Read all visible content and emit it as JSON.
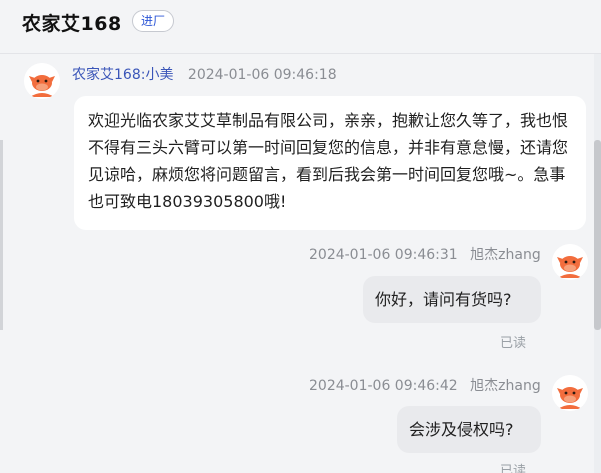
{
  "header": {
    "shop_name": "农家艾168",
    "enter_label": "进厂"
  },
  "messages": [
    {
      "side": "left",
      "sender": "农家艾168:小美",
      "time": "2024-01-06 09:46:18",
      "avatar": "cow-mascot-icon",
      "text": "欢迎光临农家艾艾草制品有限公司，亲亲，抱歉让您久等了，我也恨不得有三头六臂可以第一时间回复您的信息，并非有意怠慢，还请您见谅哈，麻烦您将问题留言，看到后我会第一时间回复您哦~。急事也可致电18039305800哦!"
    },
    {
      "side": "right",
      "sender": "旭杰zhang",
      "time": "2024-01-06 09:46:31",
      "avatar": "cow-mascot-icon",
      "text": "你好，请问有货吗?",
      "status": "已读"
    },
    {
      "side": "right",
      "sender": "旭杰zhang",
      "time": "2024-01-06 09:46:42",
      "avatar": "cow-mascot-icon",
      "text": "会涉及侵权吗?",
      "status": "已读"
    }
  ],
  "colors": {
    "accent": "#2b55d6",
    "nick": "#3a55b8",
    "mascot": "#f26d3d",
    "bubble_mine": "#e9eaed"
  }
}
